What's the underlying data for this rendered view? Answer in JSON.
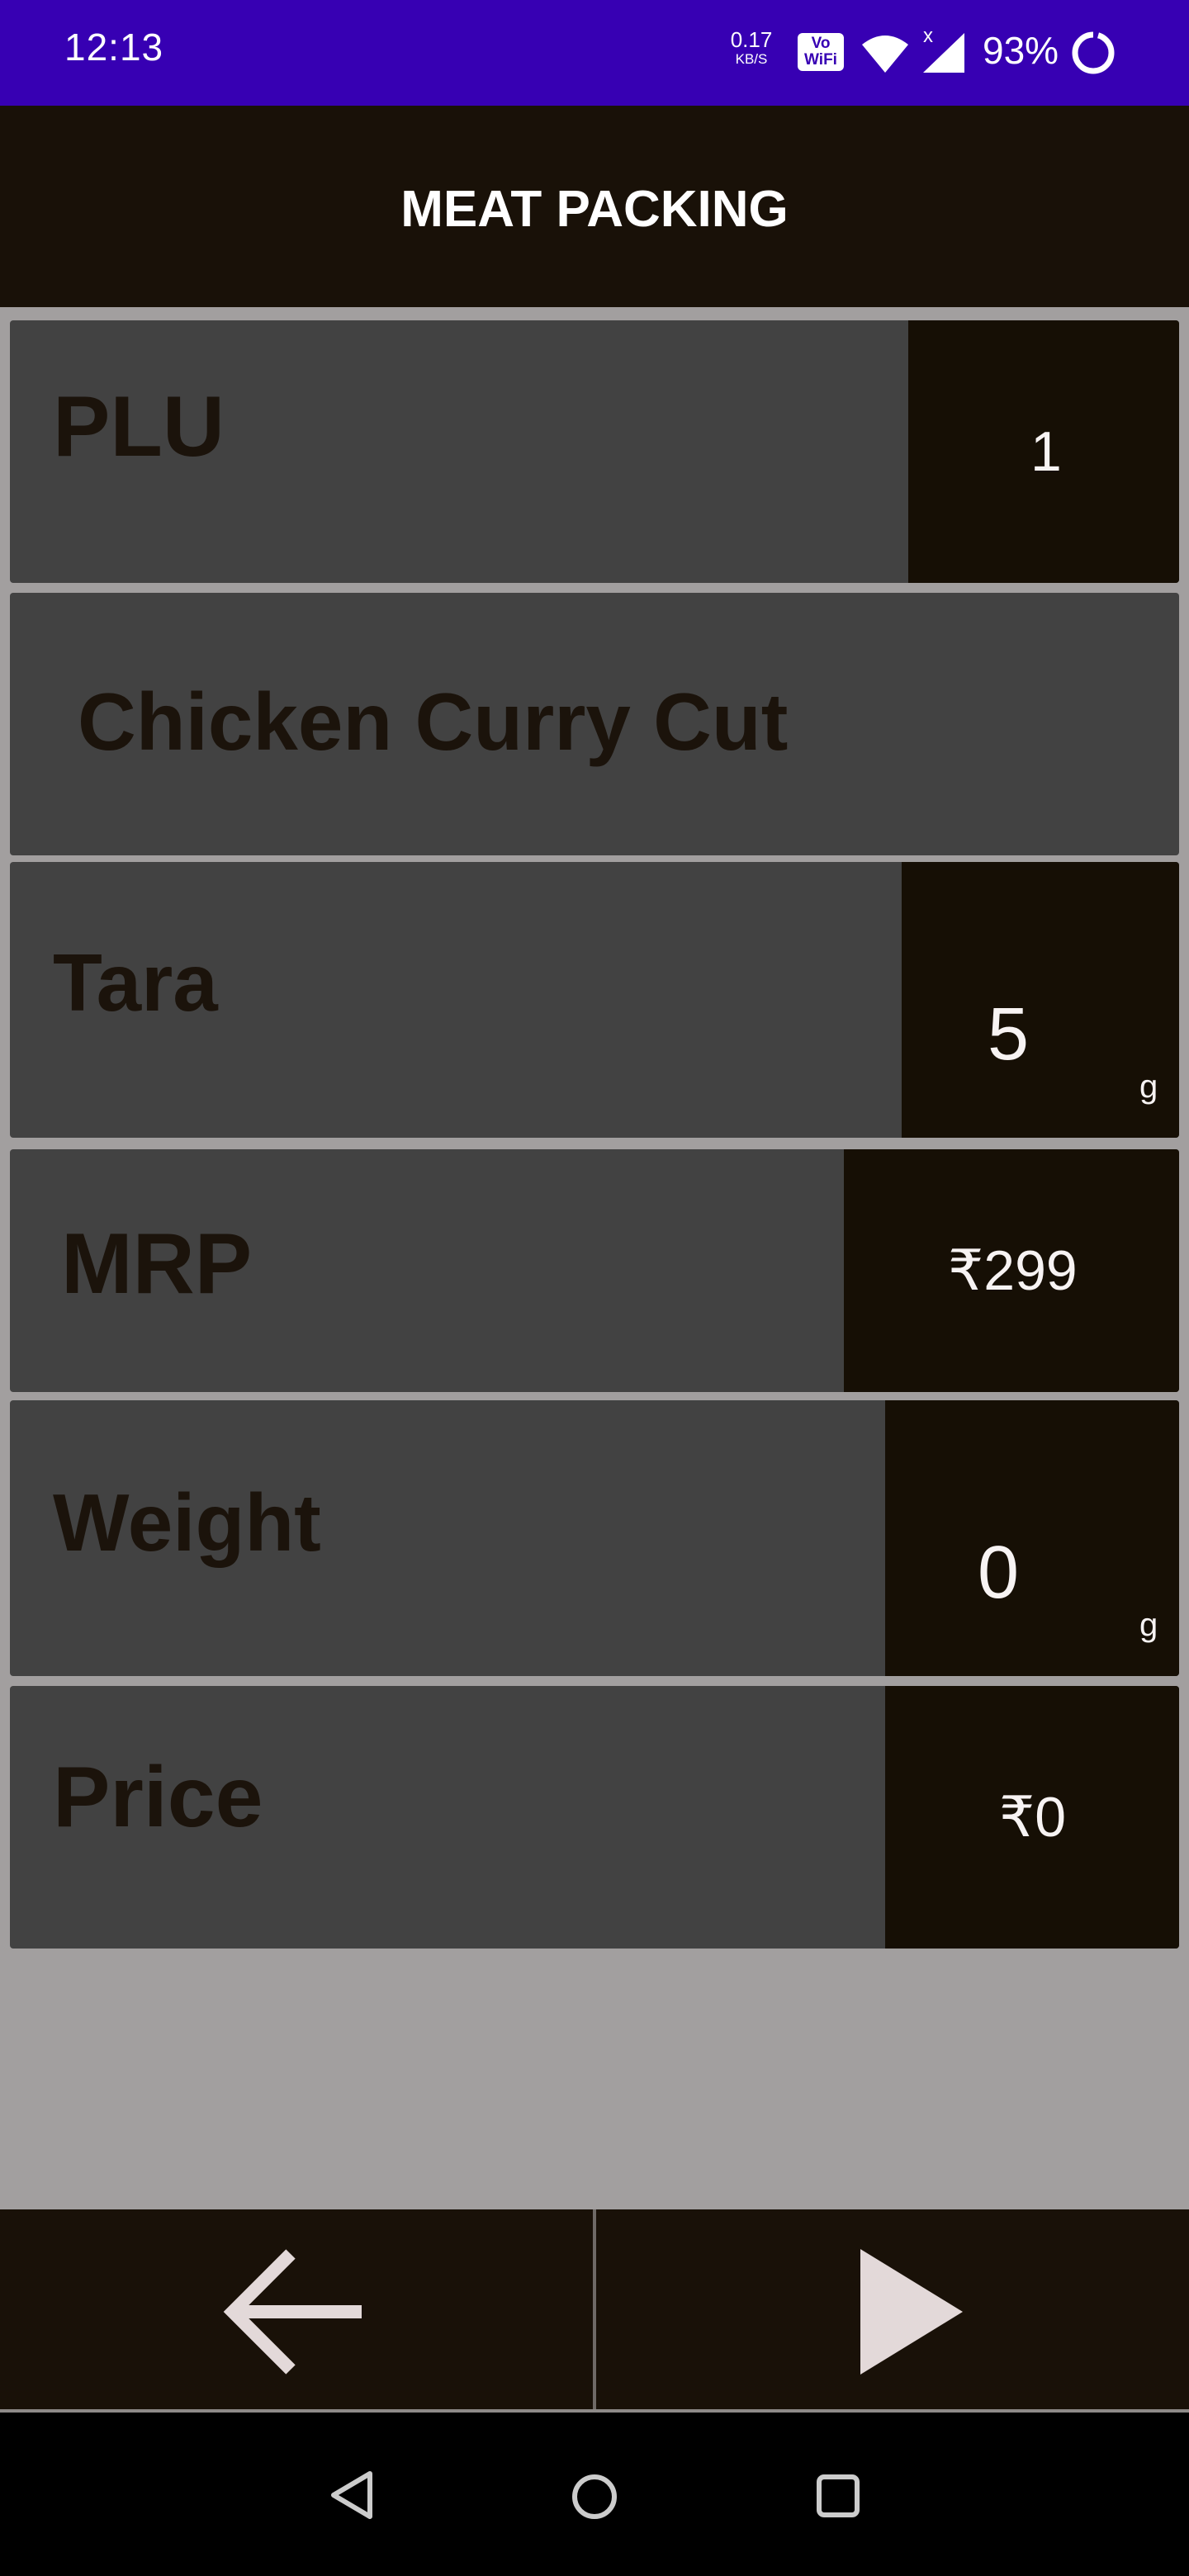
{
  "status_bar": {
    "time": "12:13",
    "net_speed": "0.17",
    "net_unit": "KB/S",
    "volte_line1": "Vo",
    "volte_line2": "WiFi",
    "signal_x": "x",
    "battery": "93%"
  },
  "app": {
    "title": "MEAT PACKING"
  },
  "fields": {
    "plu": {
      "label": "PLU",
      "value": "1"
    },
    "product": {
      "label": "Chicken Curry Cut"
    },
    "tara": {
      "label": "Tara",
      "value": "5",
      "unit": "g"
    },
    "mrp": {
      "label": "MRP",
      "value": "₹299"
    },
    "weight": {
      "label": "Weight",
      "value": "0",
      "unit": "g"
    },
    "price": {
      "label": "Price",
      "value": "₹0"
    }
  },
  "bottom_nav": {
    "back_icon": "arrow-left-icon",
    "next_icon": "play-icon"
  },
  "system_nav": {
    "back_icon": "triangle-back-icon",
    "home_icon": "circle-home-icon",
    "recents_icon": "square-recents-icon"
  },
  "colors": {
    "status_bar": "#3700b3",
    "app_bar": "#191108",
    "row_bg": "#424242",
    "value_bg": "#160f05",
    "page_bg": "#a29f9f"
  }
}
